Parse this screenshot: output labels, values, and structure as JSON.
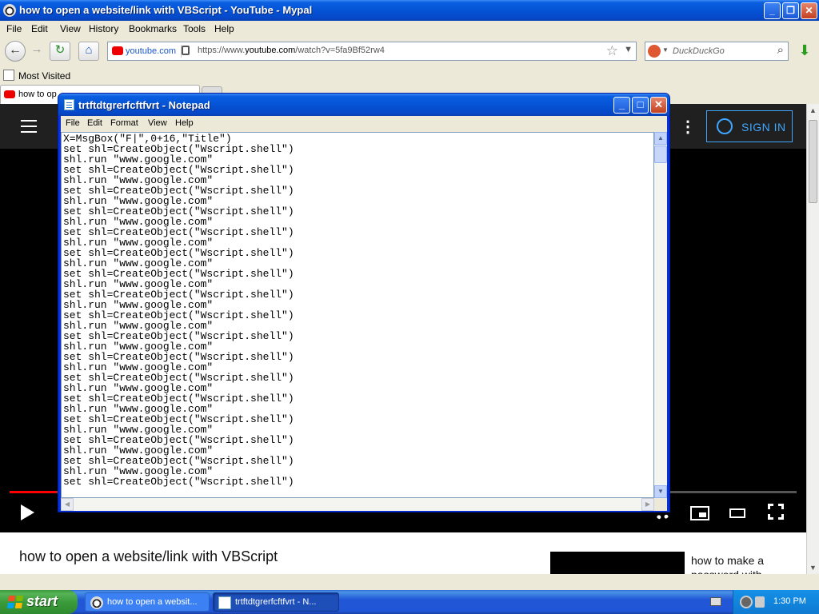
{
  "browser": {
    "title": "how to open a website/link with VBScript - YouTube - Mypal",
    "menu": [
      "File",
      "Edit",
      "View",
      "History",
      "Bookmarks",
      "Tools",
      "Help"
    ],
    "url_site": "youtube.com",
    "url_prefix": "https://www.",
    "url_domain": "youtube.com",
    "url_path": "/watch?v=5fa9Bf52rw4",
    "search_placeholder": "DuckDuckGo",
    "bookmark": "Most Visited",
    "tab_label": "how to op",
    "accent": "#0553d6"
  },
  "youtube": {
    "signin_label": "SIGN IN",
    "video_title": "how to open a website/link with VBScript",
    "rec_title": "how to make a password with",
    "progress": 0.06,
    "brand_color": "#ff0000"
  },
  "notepad": {
    "title": "trtftdtgrerfcftfvrt - Notepad",
    "menu": [
      "File",
      "Edit",
      "Format",
      "View",
      "Help"
    ],
    "lines": [
      "X=MsgBox(\"F|\",0+16,\"Title\")",
      "set shl=CreateObject(\"Wscript.shell\")",
      "shl.run \"www.google.com\"",
      "set shl=CreateObject(\"Wscript.shell\")",
      "shl.run \"www.google.com\"",
      "set shl=CreateObject(\"Wscript.shell\")",
      "shl.run \"www.google.com\"",
      "set shl=CreateObject(\"Wscript.shell\")",
      "shl.run \"www.google.com\"",
      "set shl=CreateObject(\"Wscript.shell\")",
      "shl.run \"www.google.com\"",
      "set shl=CreateObject(\"Wscript.shell\")",
      "shl.run \"www.google.com\"",
      "set shl=CreateObject(\"Wscript.shell\")",
      "shl.run \"www.google.com\"",
      "set shl=CreateObject(\"Wscript.shell\")",
      "shl.run \"www.google.com\"",
      "set shl=CreateObject(\"Wscript.shell\")",
      "shl.run \"www.google.com\"",
      "set shl=CreateObject(\"Wscript.shell\")",
      "shl.run \"www.google.com\"",
      "set shl=CreateObject(\"Wscript.shell\")",
      "shl.run \"www.google.com\"",
      "set shl=CreateObject(\"Wscript.shell\")",
      "shl.run \"www.google.com\"",
      "set shl=CreateObject(\"Wscript.shell\")",
      "shl.run \"www.google.com\"",
      "set shl=CreateObject(\"Wscript.shell\")",
      "shl.run \"www.google.com\"",
      "set shl=CreateObject(\"Wscript.shell\")",
      "shl.run \"www.google.com\"",
      "set shl=CreateObject(\"Wscript.shell\")",
      "shl.run \"www.google.com\"",
      "set shl=CreateObject(\"Wscript.shell\")"
    ]
  },
  "taskbar": {
    "start_label": "start",
    "tasks": [
      "how to open a websit...",
      "trtftdtgrerfcftfvrt - N..."
    ],
    "clock": "1:30 PM"
  }
}
